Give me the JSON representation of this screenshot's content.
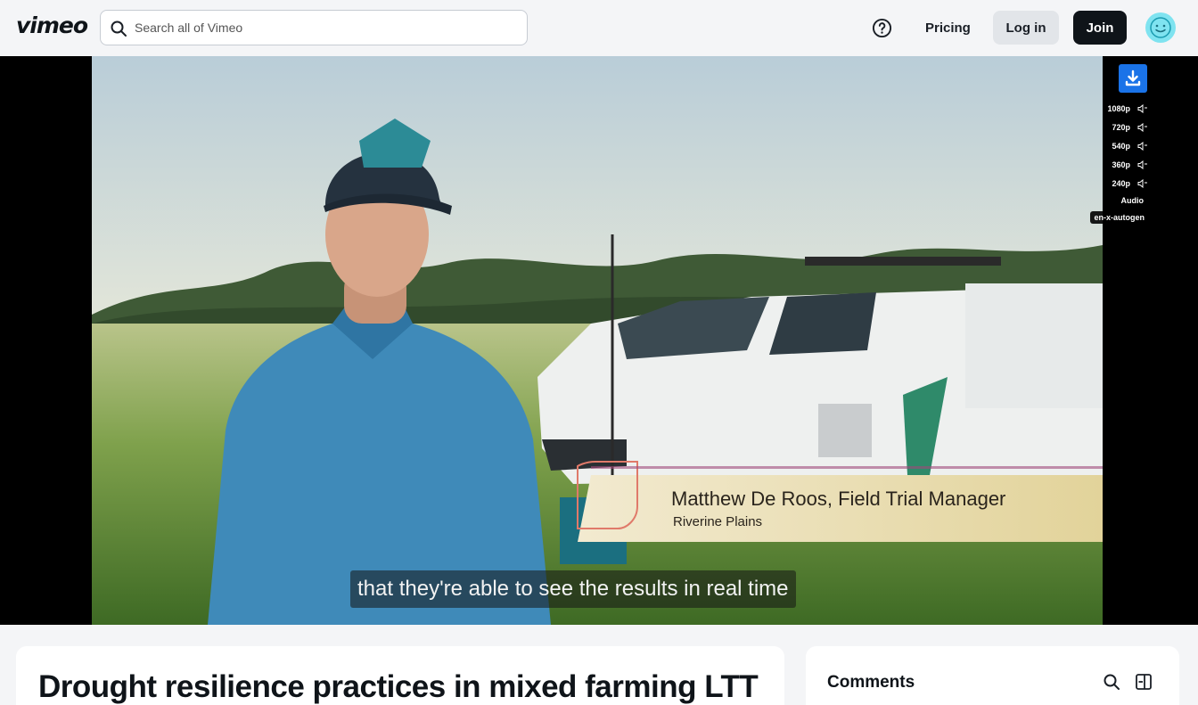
{
  "header": {
    "logo": "vimeo",
    "search_placeholder": "Search all of Vimeo",
    "pricing_label": "Pricing",
    "login_label": "Log in",
    "join_label": "Join",
    "icons": [
      "search-icon",
      "help-icon",
      "avatar-icon"
    ]
  },
  "player": {
    "lower_third_name": "Matthew De Roos, Field Trial Manager",
    "lower_third_org": "Riverine Plains",
    "caption": "that they're able to see the results in real time",
    "download_icon": "download-icon",
    "quality_options": [
      "1080p",
      "720p",
      "540p",
      "360p",
      "240p"
    ],
    "audio_label": "Audio",
    "text_track": "en-x-autogen"
  },
  "main": {
    "title": "Drought resilience practices in mixed farming LTT"
  },
  "comments": {
    "heading": "Comments",
    "icons": [
      "search-icon",
      "panel-icon"
    ]
  },
  "colors": {
    "accent_blue": "#1a73e8",
    "join_bg": "#0f1419",
    "avatar": "#7fe3f0",
    "page_bg": "#f4f5f7"
  }
}
